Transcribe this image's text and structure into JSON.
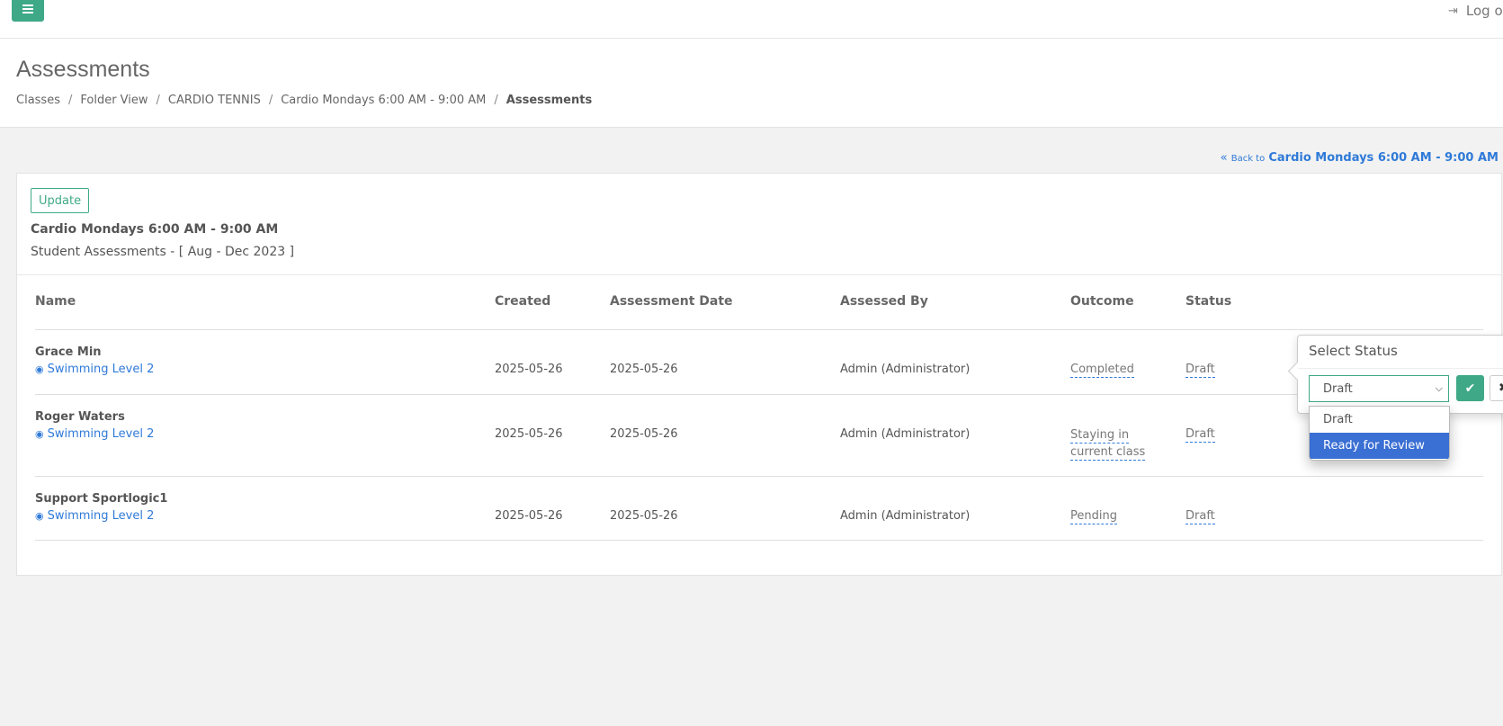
{
  "topbar": {
    "logout_label": "Log out"
  },
  "header": {
    "title": "Assessments",
    "breadcrumb": [
      "Classes",
      "Folder View",
      "CARDIO TENNIS",
      "Cardio Mondays 6:00 AM - 9:00 AM",
      "Assessments"
    ]
  },
  "back_link": {
    "prefix": "Back to",
    "target": "Cardio Mondays 6:00 AM - 9:00 AM"
  },
  "panel": {
    "update_label": "Update",
    "class_title": "Cardio Mondays 6:00 AM - 9:00 AM",
    "subtitle": "Student Assessments - [ Aug - Dec 2023 ]"
  },
  "table": {
    "headers": [
      "Name",
      "Created",
      "Assessment Date",
      "Assessed By",
      "Outcome",
      "Status"
    ],
    "rows": [
      {
        "name": "Grace Min",
        "level": "Swimming Level 2",
        "created": "2025-05-26",
        "date": "2025-05-26",
        "assessed_by": "Admin (Administrator)",
        "outcome_line1": "Completed",
        "outcome_line2": "",
        "status": "Draft"
      },
      {
        "name": "Roger Waters",
        "level": "Swimming Level 2",
        "created": "2025-05-26",
        "date": "2025-05-26",
        "assessed_by": "Admin (Administrator)",
        "outcome_line1": "Staying in",
        "outcome_line2": "current class",
        "status": "Draft"
      },
      {
        "name": "Support Sportlogic1",
        "level": "Swimming Level 2",
        "created": "2025-05-26",
        "date": "2025-05-26",
        "assessed_by": "Admin (Administrator)",
        "outcome_line1": "Pending",
        "outcome_line2": "",
        "status": "Draft"
      }
    ]
  },
  "status_popover": {
    "title": "Select Status",
    "selected_value": "Draft",
    "options": [
      "Draft",
      "Ready for Review"
    ],
    "highlighted_option": "Ready for Review"
  },
  "colors": {
    "accent_green": "#3fa987",
    "link_blue": "#2f7ad8",
    "highlight_blue": "#3a6fd3"
  },
  "icons": [
    "menu-icon",
    "logout-icon",
    "double-chevron-left-icon",
    "eye-icon",
    "check-icon",
    "close-icon",
    "chevron-down-icon"
  ]
}
